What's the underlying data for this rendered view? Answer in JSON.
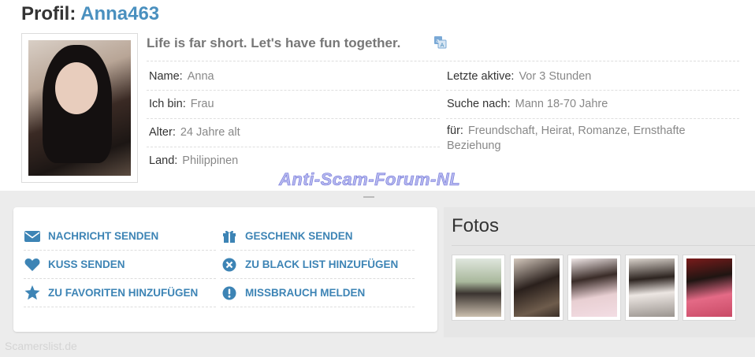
{
  "profile": {
    "title_prefix": "Profil:",
    "username": "Anna463",
    "bio": "Life is far short. Let's have fun together."
  },
  "fields": {
    "name": {
      "label": "Name:",
      "value": "Anna"
    },
    "gender": {
      "label": "Ich bin:",
      "value": "Frau"
    },
    "age": {
      "label": "Alter:",
      "value": "24 Jahre alt"
    },
    "country": {
      "label": "Land:",
      "value": "Philippinen"
    },
    "last_active": {
      "label": "Letzte aktive:",
      "value": "Vor 3 Stunden"
    },
    "seeking": {
      "label": "Suche nach:",
      "value": "Mann 18-70 Jahre"
    },
    "for": {
      "label": "für:",
      "value": "Freundschaft, Heirat, Romanze, Ernsthafte Beziehung"
    }
  },
  "watermark": "Anti-Scam-Forum-NL",
  "actions": {
    "send_message": "NACHRICHT SENDEN",
    "send_kiss": "KUSS SENDEN",
    "add_favorite": "ZU FAVORITEN HINZUFÜGEN",
    "send_gift": "GESCHENK SENDEN",
    "add_blacklist": "ZU BLACK LIST HINZUFÜGEN",
    "report_abuse": "MISSBRAUCH MELDEN"
  },
  "photos": {
    "title": "Fotos"
  },
  "footer": "Scamerslist.de",
  "colors": {
    "accent": "#3d84b5",
    "username": "#4a90bf",
    "watermark": "#b6b8ef"
  },
  "icons": {
    "send_message": "envelope-icon",
    "send_kiss": "heart-icon",
    "add_favorite": "star-icon",
    "send_gift": "gift-icon",
    "add_blacklist": "x-circle-icon",
    "report_abuse": "exclamation-circle-icon",
    "translate": "translate-icon"
  }
}
